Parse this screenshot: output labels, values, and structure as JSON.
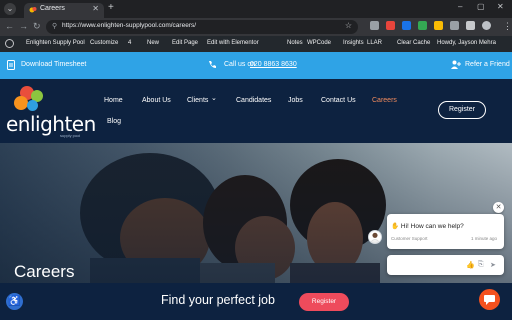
{
  "browser": {
    "tab_title": "Careers",
    "close_glyph": "✕",
    "new_tab_glyph": "+",
    "url": "https://www.enlighten-supplypool.com/careers/",
    "back_glyph": "←",
    "forward_glyph": "→",
    "reload_glyph": "↻",
    "menu_glyph": "⌄",
    "minimize_glyph": "–",
    "maximize_glyph": "▢",
    "close_window_glyph": "✕",
    "star_glyph": "☆",
    "lock_glyph": "⚲",
    "more_glyph": "⋮"
  },
  "wp_admin": {
    "site_name": "Enlighten Supply Pool",
    "customize": "Customize",
    "comments_count": "4",
    "new": "New",
    "edit_page": "Edit Page",
    "edit_elementor": "Edit with Elementor",
    "notes": "Notes",
    "wpcode": "WPCode",
    "insights": "Insights",
    "llar": "LLAR",
    "clear_cache": "Clear Cache",
    "howdy": "Howdy, Jayson Mehra"
  },
  "topbar": {
    "download": "Download Timesheet",
    "call_prefix": "Call us on",
    "phone": "020 8863 8630",
    "refer": "Refer a Friend"
  },
  "logo": {
    "name": "enlighten",
    "sub": "supply pool"
  },
  "nav": {
    "home": "Home",
    "about": "About Us",
    "clients": "Clients",
    "clients_caret": "⌄",
    "candidates": "Candidates",
    "jobs": "Jobs",
    "contact": "Contact Us",
    "careers": "Careers",
    "blog": "Blog",
    "register": "Register"
  },
  "hero": {
    "title": "Careers"
  },
  "footer": {
    "find": "Find your perfect job",
    "register": "Register"
  },
  "chat": {
    "message": "Hi! How can we help?",
    "agent": "Customer Support",
    "time": "1 minute ago",
    "close_glyph": "✕"
  },
  "colors": {
    "topbar": "#2fa3e6",
    "navy": "#0d2240",
    "careers_active": "#f08a5d",
    "register_pill": "#ee4b5c",
    "chat_launcher": "#f4511e"
  }
}
